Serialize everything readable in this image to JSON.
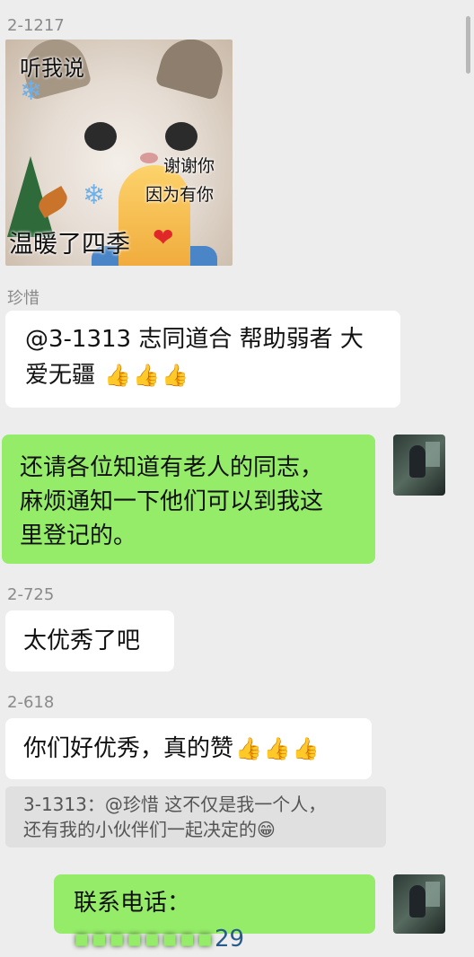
{
  "messages": {
    "m1": {
      "sender": "2-1217",
      "sticker": {
        "line1": "听我说",
        "line2": "谢谢你",
        "line3": "因为有你",
        "line4": "温暖了四季"
      }
    },
    "m2": {
      "sender": "珍惜",
      "line1": "@3-1313 志同道合 帮助弱者 大",
      "line2": "爱无疆"
    },
    "m3": {
      "line1": "还请各位知道有老人的同志，",
      "line2": "麻烦通知一下他们可以到我这",
      "line3": "里登记的。"
    },
    "m4": {
      "sender": "2-725",
      "text": "太优秀了吧"
    },
    "m5": {
      "sender": "2-618",
      "text": "你们好优秀，真的赞",
      "quote_line1": "3-1313：@珍惜 这不仅是我一个人，",
      "quote_line2": "还有我的小伙伴们一起决定的"
    },
    "m6": {
      "prefix": "联系电话：",
      "suffix": "29"
    }
  },
  "icons": {
    "thumbs_up": "👍",
    "grin": "😁",
    "snowflake": "❄",
    "heart": "❤"
  },
  "colors": {
    "background": "#ededed",
    "bubble_self": "#95ec69",
    "bubble_other": "#ffffff"
  }
}
